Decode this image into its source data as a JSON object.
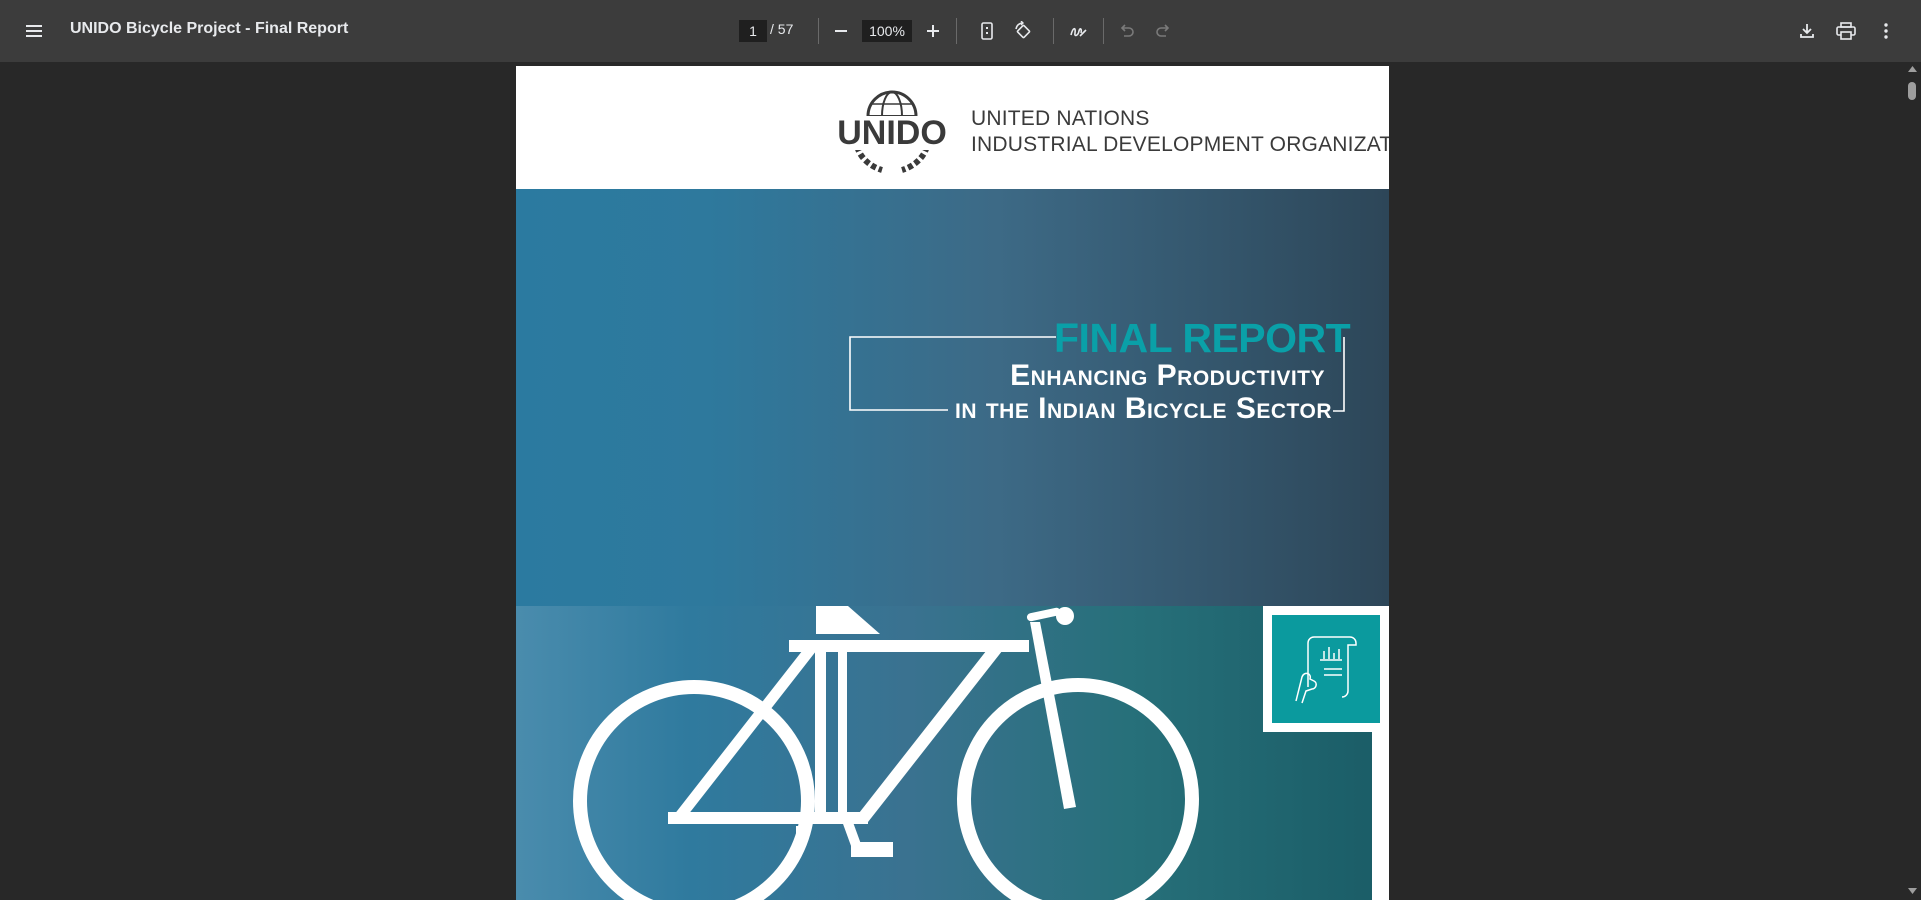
{
  "toolbar": {
    "menu_icon": "menu-icon",
    "title": "UNIDO Bicycle Project - Final Report",
    "page_current": "1",
    "page_total": "/ 57",
    "zoom": "100%",
    "icons": [
      "zoom-out-icon",
      "zoom-in-icon",
      "fit-page-icon",
      "rotate-icon",
      "annotate-icon",
      "undo-icon",
      "redo-icon",
      "download-icon",
      "print-icon",
      "more-icon"
    ]
  },
  "document": {
    "org_line1": "UNITED NATIONS",
    "org_line2": "INDUSTRIAL DEVELOPMENT ORGANIZATION",
    "final_report": "FINAL REPORT",
    "subtitle_line1": "Enhancing Productivity",
    "subtitle_line2": "in the Indian Bicycle Sector",
    "logo_text": "UNIDO"
  },
  "colors": {
    "toolbar_bg": "#3c3c3c",
    "viewer_bg": "#282828",
    "accent_teal": "#0aa0a8",
    "hero_blue": "#2e799d"
  }
}
